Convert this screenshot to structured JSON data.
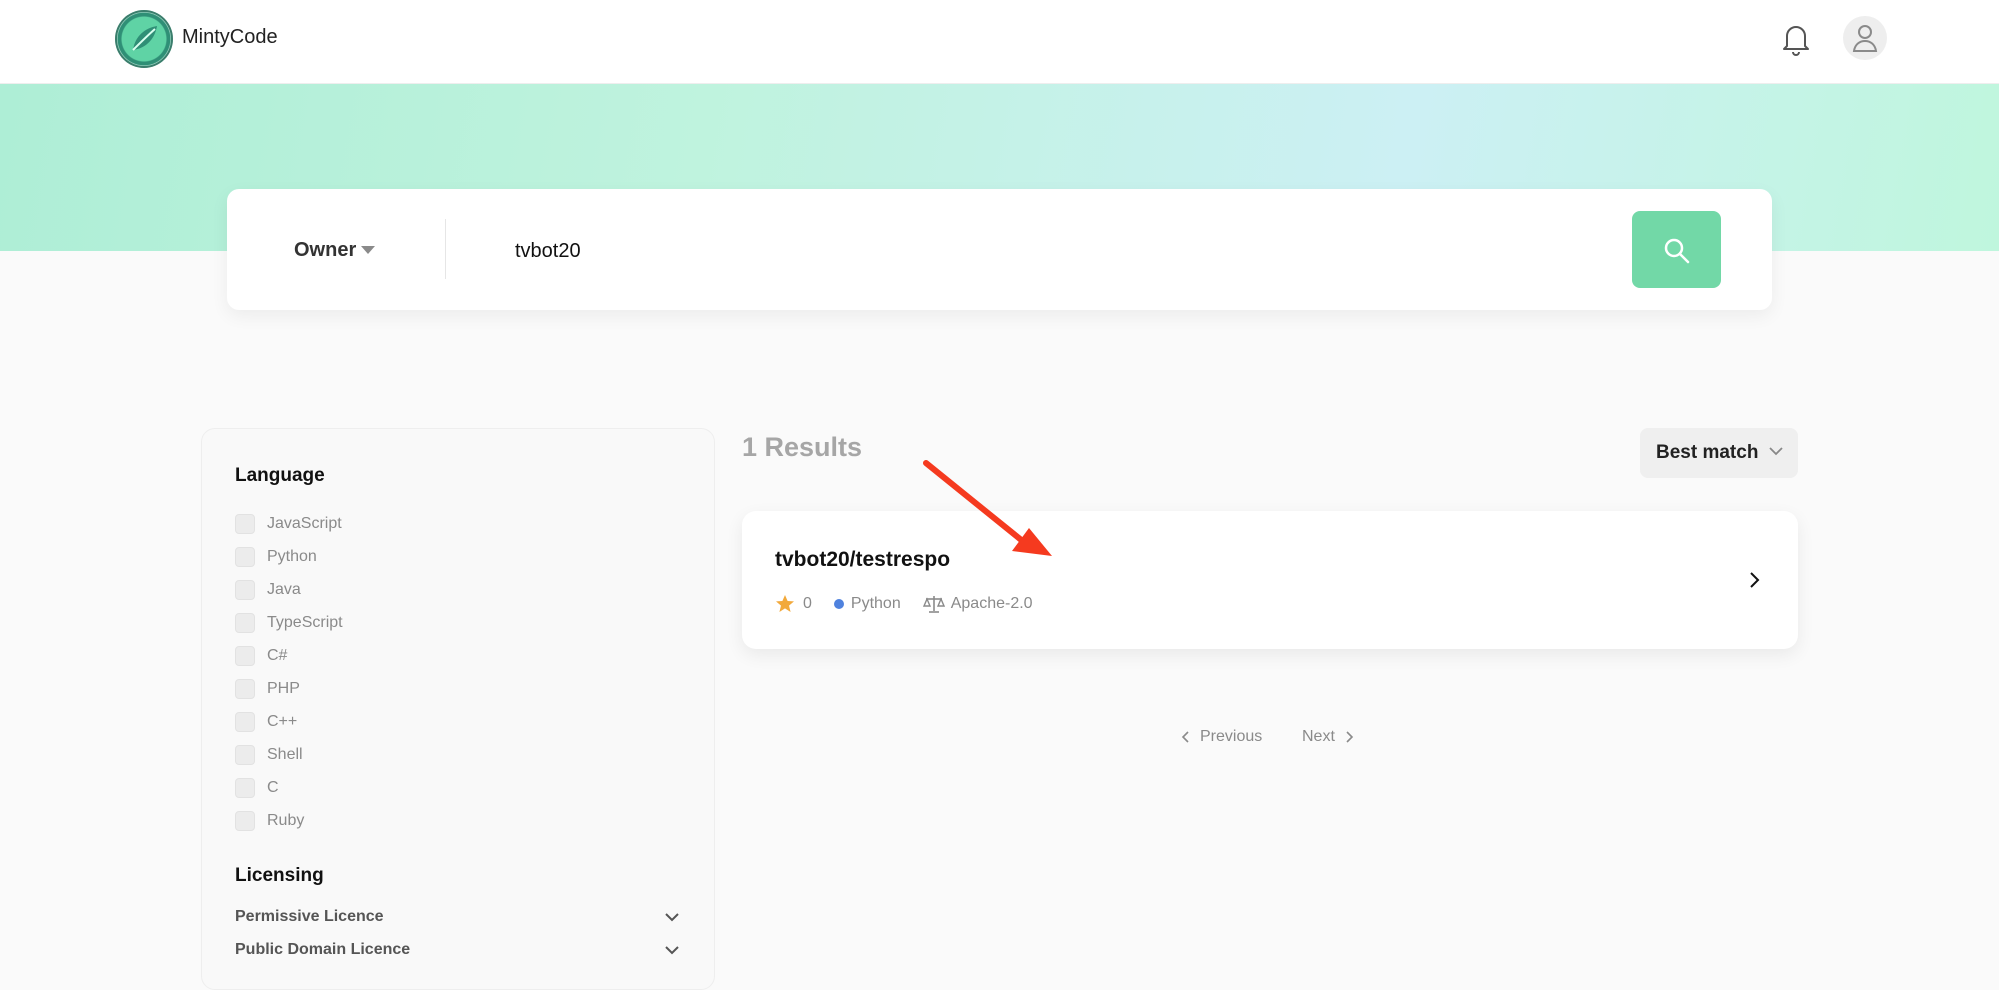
{
  "header": {
    "brand": "MintyCode",
    "icons": {
      "logo": "leaf-logo-icon",
      "notifications": "bell-icon",
      "user": "user-avatar-icon"
    }
  },
  "search": {
    "scope_label": "Owner",
    "query": "tvbot20",
    "button_icon": "search-icon"
  },
  "filters": {
    "language_title": "Language",
    "languages": [
      "JavaScript",
      "Python",
      "Java",
      "TypeScript",
      "C#",
      "PHP",
      "C++",
      "Shell",
      "C",
      "Ruby"
    ],
    "licensing_title": "Licensing",
    "licences": [
      "Permissive Licence",
      "Public Domain Licence"
    ]
  },
  "results": {
    "count_label": "1 Results",
    "sort_label": "Best match",
    "items": [
      {
        "name": "tvbot20/testrespo",
        "stars": "0",
        "language": "Python",
        "license": "Apache-2.0"
      }
    ]
  },
  "pagination": {
    "previous": "Previous",
    "next": "Next"
  },
  "colors": {
    "accent": "#72d8a7",
    "hero_gradient_start": "#aeeed6",
    "hero_gradient_end": "#ccf0f4",
    "star": "#f2a93b",
    "python_dot": "#4f82de",
    "annotation_arrow": "#f53a1f"
  }
}
